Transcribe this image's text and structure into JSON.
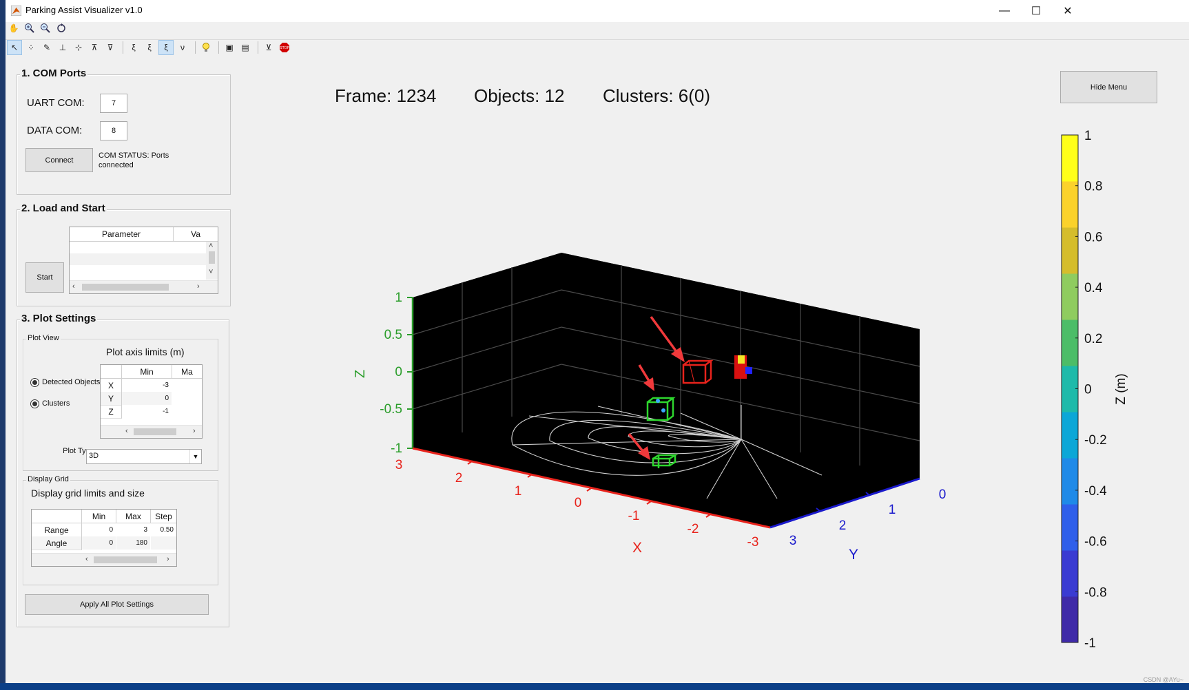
{
  "window": {
    "title": "Parking Assist Visualizer v1.0",
    "minimize": "—",
    "maximize": "☐",
    "close": "✕"
  },
  "toolbar_top": [
    "pan-icon",
    "zoom-in-icon",
    "zoom-out-icon",
    "rotate-icon"
  ],
  "toolbar_main": [
    "select-icon",
    "data-cursor-icon",
    "brush-icon",
    "insert-icon",
    "tool-5-icon",
    "tool-6-icon",
    "axes-x-icon",
    "axes-y-icon",
    "axes-z-icon",
    "axes-v-icon",
    "light-icon",
    "view-icon",
    "view2-icon",
    "plot-tool-icon",
    "stop-icon"
  ],
  "com_ports": {
    "title": "1. COM Ports",
    "uart_label": "UART COM:",
    "uart_value": "7",
    "data_label": "DATA COM:",
    "data_value": "8",
    "connect_label": "Connect",
    "status": "COM STATUS: Ports connected"
  },
  "load_start": {
    "title": "2. Load and Start",
    "start_label": "Start",
    "table_headers": [
      "Parameter",
      "Va"
    ]
  },
  "plot_settings": {
    "title": "3. Plot Settings",
    "plot_view_title": "Plot View",
    "axis_limits_label": "Plot axis limits (m)",
    "radio_detected": "Detected Objects",
    "radio_clusters": "Clusters",
    "axis_table_headers": [
      "Min",
      "Ma"
    ],
    "axis_rows": [
      {
        "name": "X",
        "min": "-3"
      },
      {
        "name": "Y",
        "min": "0"
      },
      {
        "name": "Z",
        "min": "-1"
      }
    ],
    "plot_type_label": "Plot Type",
    "plot_type_value": "3D",
    "display_grid_title": "Display Grid",
    "grid_label": "Display grid limits and size",
    "grid_headers": [
      "Min",
      "Max",
      "Step"
    ],
    "grid_rows": [
      {
        "name": "Range",
        "min": "0",
        "max": "3",
        "step": "0.50"
      },
      {
        "name": "Angle",
        "min": "0",
        "max": "180",
        "step": ""
      }
    ],
    "apply_label": "Apply All Plot Settings"
  },
  "stats": {
    "frame": "Frame: 1234",
    "objects": "Objects: 12",
    "clusters": "Clusters: 6(0)"
  },
  "hide_menu_label": "Hide Menu",
  "watermark": "CSDN @AYu~",
  "colors": {
    "x_axis": "#e8231c",
    "y_axis": "#1a1acc",
    "z_axis": "#2a9d2a",
    "grid_line": "#4a4a4a",
    "plot_bg": "#000000"
  },
  "chart_data": {
    "type": "scatter",
    "x_label": "X",
    "y_label": "Y",
    "z_label": "Z",
    "x_ticks": [
      "3",
      "2",
      "1",
      "0",
      "-1",
      "-2",
      "-3"
    ],
    "y_ticks": [
      "3",
      "2",
      "1",
      "0"
    ],
    "z_ticks": [
      "1",
      "0.5",
      "0",
      "-0.5",
      "-1"
    ],
    "xlim": [
      -3,
      3
    ],
    "ylim": [
      0,
      3
    ],
    "zlim": [
      -1,
      1
    ],
    "colorbar": {
      "label": "Z (m)",
      "ticks": [
        "1",
        "0.8",
        "0.6",
        "0.4",
        "0.2",
        "0",
        "-0.2",
        "-0.4",
        "-0.6",
        "-0.8",
        "-1"
      ],
      "colors": [
        "#ffff18",
        "#fbd22b",
        "#d5bd2c",
        "#8fcc5f",
        "#4cbd68",
        "#1ebaaa",
        "#0ca7d7",
        "#1f8ae8",
        "#2f5fea",
        "#3a3bd2",
        "#3f2aa8"
      ]
    },
    "objects": [
      {
        "type": "cluster-box",
        "color": "#e8231c",
        "x": -0.8,
        "y": 1.0,
        "z": 0.0
      },
      {
        "type": "cluster-box",
        "color": "#2ed62e",
        "x": -0.2,
        "y": 1.7,
        "z": -0.5
      },
      {
        "type": "cluster-box",
        "color": "#2ed62e",
        "x": -0.4,
        "y": 2.5,
        "z": -1.0
      },
      {
        "type": "cluster-box",
        "color": "#e8231c",
        "x": -1.8,
        "y": 0.8,
        "z": 0.0
      }
    ]
  }
}
